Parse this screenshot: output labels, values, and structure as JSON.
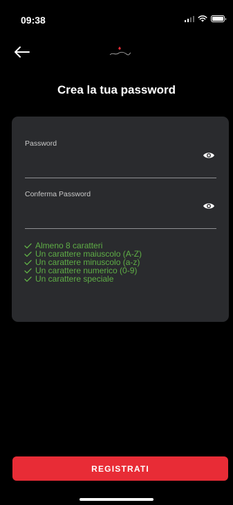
{
  "status_bar": {
    "time": "09:38"
  },
  "header": {
    "logo_icon": "brand-logo-icon",
    "back_icon": "arrow-left-icon"
  },
  "page": {
    "title": "Crea la tua password"
  },
  "form": {
    "password": {
      "label": "Password",
      "value": "",
      "icon": "eye-icon"
    },
    "confirm_password": {
      "label": "Conferma Password",
      "value": "",
      "icon": "eye-icon"
    }
  },
  "requirements": [
    {
      "label": "Almeno 8 caratteri",
      "met": true
    },
    {
      "label": "Un carattere maiuscolo (A-Z)",
      "met": true
    },
    {
      "label": "Un carattere minuscolo (a-z)",
      "met": true
    },
    {
      "label": "Un carattere numerico (0-9)",
      "met": true
    },
    {
      "label": "Un carattere speciale",
      "met": true
    }
  ],
  "actions": {
    "register_label": "REGISTRATI"
  },
  "colors": {
    "background": "#000000",
    "card": "#2a2b2e",
    "accent": "#e82c36",
    "success": "#5fae46"
  }
}
